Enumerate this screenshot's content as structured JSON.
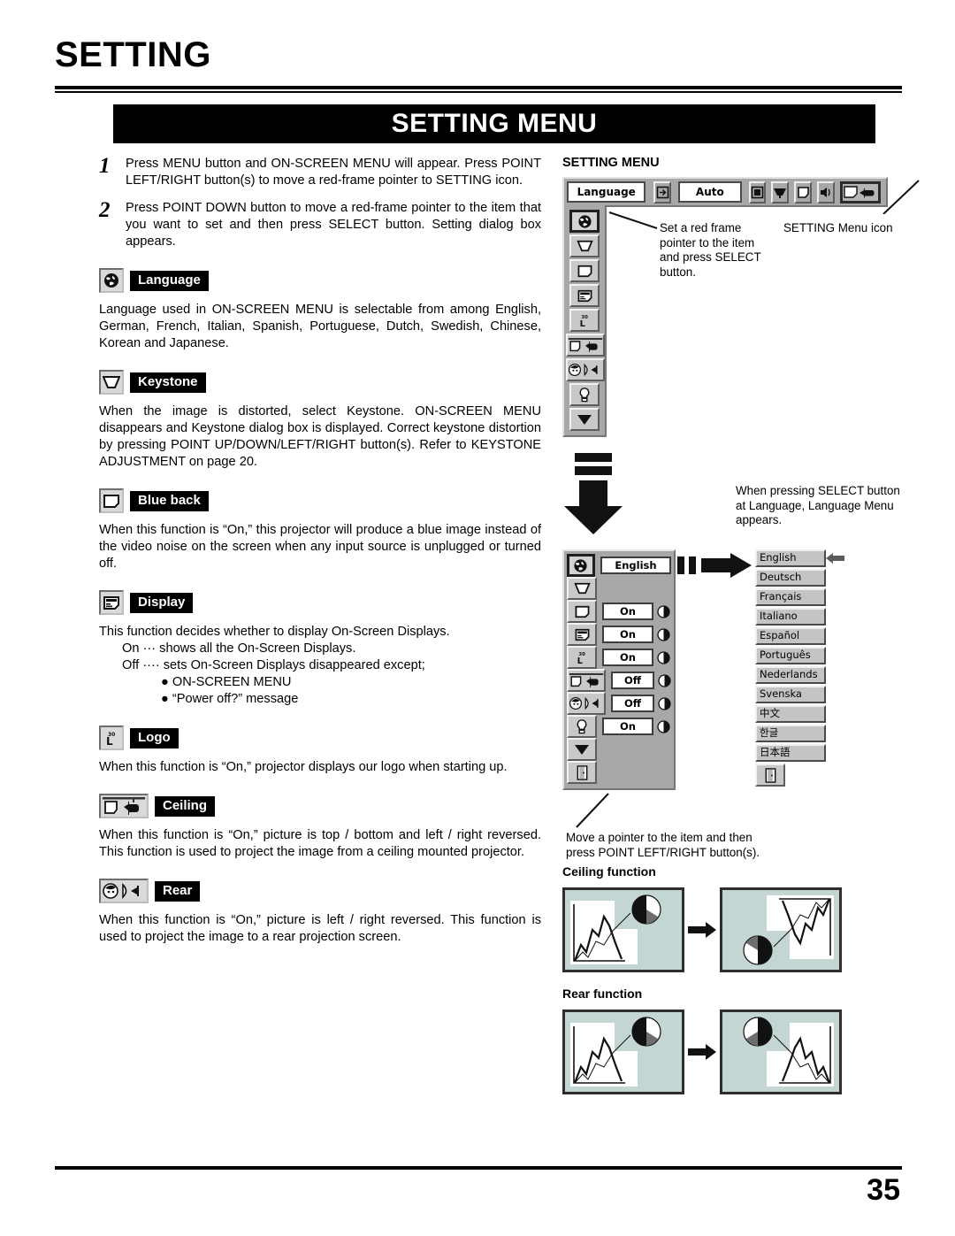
{
  "page": {
    "header_title": "SETTING",
    "banner_title": "SETTING MENU",
    "number": "35"
  },
  "steps": [
    {
      "num": "1",
      "text": "Press MENU button and ON-SCREEN MENU will appear.  Press POINT LEFT/RIGHT button(s) to move a red-frame pointer to SETTING icon."
    },
    {
      "num": "2",
      "text": "Press POINT DOWN button to move a red-frame pointer to the item that you want to set and then press SELECT button.  Setting dialog box appears."
    }
  ],
  "sections": [
    {
      "icon": "globe-icon",
      "label": "Language",
      "body": "Language used in ON-SCREEN MENU is selectable from among English, German, French, Italian, Spanish, Portuguese, Dutch, Swedish, Chinese, Korean and Japanese."
    },
    {
      "icon": "keystone-icon",
      "label": "Keystone",
      "body": "When the image is distorted, select Keystone.  ON-SCREEN MENU disappears and Keystone dialog box is displayed.  Correct keystone distortion by pressing POINT UP/DOWN/LEFT/RIGHT button(s). Refer to KEYSTONE ADJUSTMENT on page 20."
    },
    {
      "icon": "blueback-icon",
      "label": "Blue back",
      "body": "When this function is “On,” this projector will produce a blue image instead of the video noise on the screen when any input source is unplugged or turned off."
    },
    {
      "icon": "display-icon",
      "label": "Display",
      "body": "This function decides whether to display On-Screen Displays.",
      "bullets": [
        "On  ··· shows all the On-Screen Displays.",
        "Off ···· sets On-Screen Displays disappeared except;"
      ],
      "subbullets": [
        "●  ON-SCREEN MENU",
        "●  “Power off?” message"
      ]
    },
    {
      "icon": "logo-icon",
      "label": "Logo",
      "body": "When this function is “On,” projector displays our logo when starting up."
    },
    {
      "icon": "ceiling-icon",
      "label": "Ceiling",
      "body": "When this function is “On,” picture is top / bottom and left / right reversed.  This function is used to project the image from a ceiling mounted projector."
    },
    {
      "icon": "rear-icon",
      "label": "Rear",
      "body": "When this function is “On,” picture is left / right reversed.  This function is used to project the image to a rear projection screen."
    }
  ],
  "osd": {
    "title": "SETTING MENU",
    "menubar": {
      "language_field": "Language",
      "auto_field": "Auto",
      "icons": [
        "input-icon",
        "screen-icon",
        "image-icon",
        "picture-icon",
        "sound-icon",
        "setting-icon"
      ]
    },
    "sidebar_icons": [
      "globe-icon",
      "keystone-icon",
      "blueback-icon",
      "display-icon",
      "logo-icon",
      "ceiling-icon",
      "rear-icon",
      "lamp-icon",
      "down-arrow-icon"
    ],
    "callout_pointer": "Set a red frame pointer to the item and press SELECT button.",
    "callout_menu_icon": "SETTING Menu icon",
    "callout_select": "When pressing SELECT button at Language, Language Menu appears.",
    "callout_move": "Move a pointer to the item and then press POINT LEFT/RIGHT button(s).",
    "dialog_rows": [
      {
        "icon": "globe-icon",
        "value": "English"
      },
      {
        "icon": "keystone-icon",
        "value": ""
      },
      {
        "icon": "blueback-icon",
        "value": "On"
      },
      {
        "icon": "display-icon",
        "value": "On"
      },
      {
        "icon": "logo-icon",
        "value": "On"
      },
      {
        "icon": "ceiling-icon",
        "value": "Off"
      },
      {
        "icon": "rear-icon",
        "value": "Off"
      },
      {
        "icon": "lamp-icon",
        "value": "On"
      },
      {
        "icon": "down-arrow-icon",
        "value": ""
      },
      {
        "icon": "exit-icon",
        "value": ""
      }
    ],
    "languages": [
      "English",
      "Deutsch",
      "Français",
      "Italiano",
      "Español",
      "Português",
      "Nederlands",
      "Svenska",
      "中文",
      "한글",
      "日本語"
    ],
    "language_exit_icon": "exit-icon"
  },
  "illustrations": {
    "ceiling_title": "Ceiling function",
    "rear_title": "Rear function"
  },
  "colors": {
    "banner_bg": "#000000",
    "banner_fg": "#ffffff",
    "osd_gray": "#a8a8a8",
    "screen_teal": "#c4d6d4"
  }
}
